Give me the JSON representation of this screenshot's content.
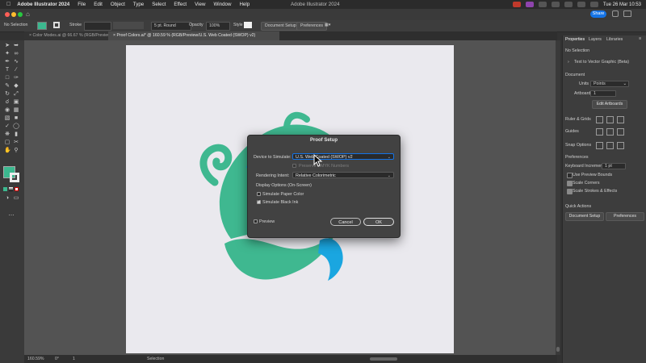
{
  "menubar": {
    "app": "Adobe Illustrator 2024",
    "items": [
      "File",
      "Edit",
      "Object",
      "Type",
      "Select",
      "Effect",
      "View",
      "Window",
      "Help"
    ],
    "center_title": "Adobe Illustrator 2024",
    "clock": "Tue 26 Mar  10:53"
  },
  "titlebar": {
    "share_label": "Share"
  },
  "control_bar": {
    "selection_label": "No Selection",
    "stroke_label": "Stroke",
    "brush_value": "5 pt. Round",
    "opacity_label": "Opacity",
    "opacity_value": "100%",
    "style_label": "Style",
    "document_setup_label": "Document Setup",
    "preferences_label": "Preferences"
  },
  "tabs": [
    {
      "label": "Color Modes.ai @ 66.67 % (RGB/Preview)",
      "active": false
    },
    {
      "label": "Proof Colors.ai* @ 160.59 % (RGB/Preview/U.S. Web Coated (SWOP) v2)",
      "active": true
    }
  ],
  "status": {
    "zoom": "160.59%",
    "angle": "0°",
    "page": "1",
    "mode": "Selection"
  },
  "panel": {
    "tabs": [
      "Properties",
      "Layers",
      "Libraries"
    ],
    "no_selection": "No Selection",
    "text_to_vector": "Text to Vector Graphic (Beta)",
    "document_heading": "Document",
    "units_label": "Units",
    "units_value": "Points",
    "artboard_label": "Artboard",
    "artboard_value": "1",
    "edit_artboards_label": "Edit Artboards",
    "rulers_grids_label": "Ruler & Grids",
    "guides_label": "Guides",
    "snap_options_label": "Snap Options",
    "preferences_heading": "Preferences",
    "keyboard_increment_label": "Keyboard Increment",
    "keyboard_increment_value": "1 pt",
    "use_preview_bounds": "Use Preview Bounds",
    "scale_corners": "Scale Corners",
    "scale_strokes": "Scale Strokes & Effects",
    "quick_actions_heading": "Quick Actions",
    "document_setup_btn": "Document Setup",
    "preferences_btn": "Preferences"
  },
  "dialog": {
    "title": "Proof Setup",
    "device_label": "Device to Simulate:",
    "device_value": "U.S. Web Coated (SWOP) v2",
    "preserve_label": "Preserve CMYK Numbers",
    "rendering_label": "Rendering Intent:",
    "rendering_value": "Relative Colorimetric",
    "display_options": "Display Options (On-Screen)",
    "simulate_paper": "Simulate Paper Color",
    "simulate_paper_checked": false,
    "simulate_ink": "Simulate Black Ink",
    "simulate_ink_checked": true,
    "preview_label": "Preview",
    "preview_checked": false,
    "cancel_label": "Cancel",
    "ok_label": "OK"
  },
  "colors": {
    "accent": "#1473e6",
    "fill_swatch": "#3cb88f",
    "art_green": "#3fb890",
    "art_blue": "#1aa6e0"
  }
}
